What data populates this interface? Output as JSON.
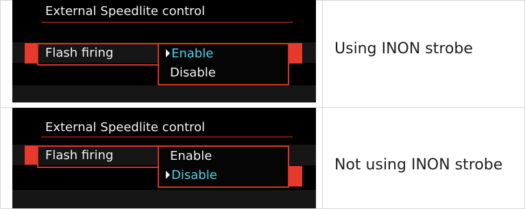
{
  "rows": [
    {
      "screen": {
        "title": "External Speedlite control",
        "item_label": "Flash firing",
        "options": [
          "Enable",
          "Disable"
        ],
        "selected_option": "Enable"
      },
      "description": "Using INON strobe"
    },
    {
      "screen": {
        "title": "External Speedlite control",
        "item_label": "Flash firing",
        "options": [
          "Enable",
          "Disable"
        ],
        "selected_option": "Disable"
      },
      "description": "Not using INON strobe"
    }
  ],
  "colors": {
    "camera_bg": "#000000",
    "highlight_red": "#e63a2d",
    "selected_cyan": "#49d6ec",
    "text_white": "#f2f2f2"
  }
}
